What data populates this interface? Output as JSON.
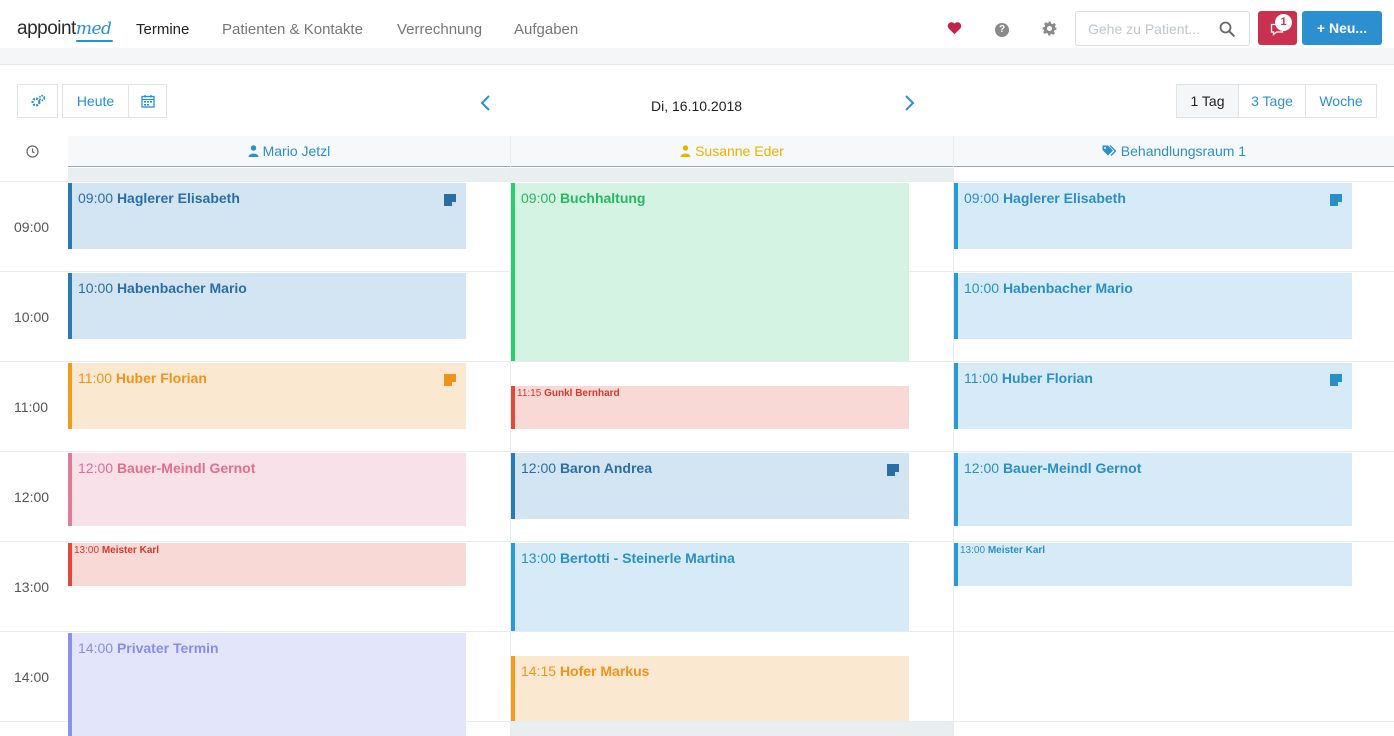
{
  "app": {
    "logo_main": "appoint",
    "logo_accent": "med"
  },
  "nav": {
    "items": [
      "Termine",
      "Patienten & Kontakte",
      "Verrechnung",
      "Aufgaben"
    ],
    "search_placeholder": "Gehe zu Patient...",
    "message_count": "1",
    "new_label": "+ Neu..."
  },
  "toolbar": {
    "today_label": "Heute",
    "date": "Di, 16.10.2018",
    "views": [
      "1 Tag",
      "3 Tage",
      "Woche"
    ],
    "active_view": "1 Tag"
  },
  "resources": [
    {
      "name": "Mario Jetzl",
      "icon": "user-doctor-icon",
      "color": "#2b8fd0"
    },
    {
      "name": "Susanne Eder",
      "icon": "user-doctor-icon",
      "color": "#e8b400"
    },
    {
      "name": "Behandlungsraum 1",
      "icon": "tags-icon",
      "color": "#2b8fd0"
    }
  ],
  "hours": [
    "09:00",
    "10:00",
    "11:00",
    "12:00",
    "13:00",
    "14:00"
  ],
  "appointments": {
    "mario": [
      {
        "time": "09:00",
        "name": "Haglerer Elisabeth",
        "note": true
      },
      {
        "time": "10:00",
        "name": "Habenbacher Mario",
        "note": false
      },
      {
        "time": "11:00",
        "name": "Huber Florian",
        "note": true
      },
      {
        "time": "12:00",
        "name": "Bauer-Meindl Gernot",
        "note": false
      },
      {
        "time": "13:00",
        "name": "Meister Karl",
        "note": false
      },
      {
        "time": "14:00",
        "name": "Privater Termin",
        "note": false
      }
    ],
    "susanne": [
      {
        "time": "09:00",
        "name": "Buchhaltung",
        "note": false
      },
      {
        "time": "11:15",
        "name": "Gunkl Bernhard",
        "note": false
      },
      {
        "time": "12:00",
        "name": "Baron Andrea",
        "note": true
      },
      {
        "time": "13:00",
        "name": "Bertotti - Steinerle Martina",
        "note": false
      },
      {
        "time": "14:15",
        "name": "Hofer Markus",
        "note": false
      }
    ],
    "raum": [
      {
        "time": "09:00",
        "name": "Haglerer Elisabeth",
        "note": true
      },
      {
        "time": "10:00",
        "name": "Habenbacher Mario",
        "note": false
      },
      {
        "time": "11:00",
        "name": "Huber Florian",
        "note": true
      },
      {
        "time": "12:00",
        "name": "Bauer-Meindl Gernot",
        "note": false
      },
      {
        "time": "13:00",
        "name": "Meister Karl",
        "note": false
      }
    ]
  },
  "colors": {
    "brand_blue": "#2b8fd0",
    "alert_red": "#c9314f",
    "heart": "#c0264d"
  }
}
